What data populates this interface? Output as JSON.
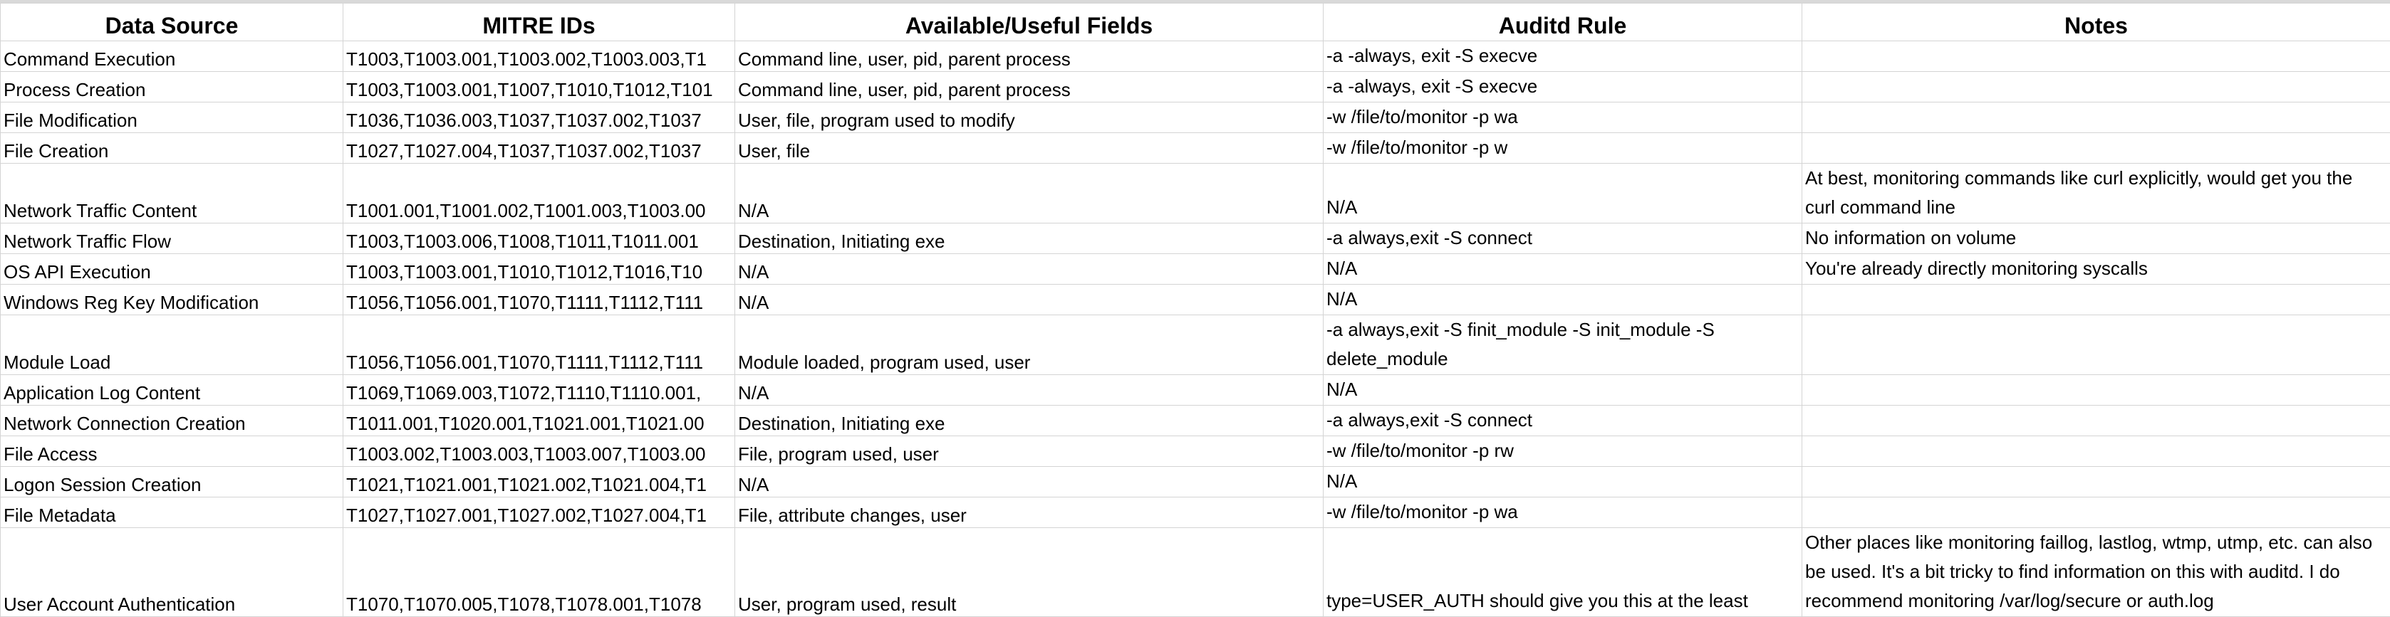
{
  "headers": [
    "Data Source",
    "MITRE IDs",
    "Available/Useful Fields",
    "Auditd Rule",
    "Notes"
  ],
  "rows": [
    {
      "source": "Command Execution",
      "ids": "T1003,T1003.001,T1003.002,T1003.003,T1",
      "fields": "Command line, user, pid, parent process",
      "rule": "-a -always, exit -S execve",
      "notes": ""
    },
    {
      "source": "Process Creation",
      "ids": "T1003,T1003.001,T1007,T1010,T1012,T101",
      "fields": "Command line, user, pid, parent process",
      "rule": "-a -always, exit -S execve",
      "notes": ""
    },
    {
      "source": "File Modification",
      "ids": "T1036,T1036.003,T1037,T1037.002,T1037",
      "fields": "User, file, program used to modify",
      "rule": "-w /file/to/monitor -p wa",
      "notes": ""
    },
    {
      "source": "File Creation",
      "ids": "T1027,T1027.004,T1037,T1037.002,T1037",
      "fields": "User, file",
      "rule": "-w /file/to/monitor -p w",
      "notes": ""
    },
    {
      "source": "Network Traffic Content",
      "ids": "T1001.001,T1001.002,T1001.003,T1003.00",
      "fields": "N/A",
      "rule": "N/A",
      "notes": "At best, monitoring commands like curl explicitly, would get you the curl command line"
    },
    {
      "source": "Network Traffic Flow",
      "ids": "T1003,T1003.006,T1008,T1011,T1011.001",
      "fields": "Destination, Initiating exe",
      "rule": "-a always,exit -S connect",
      "notes": "No information on volume"
    },
    {
      "source": "OS API Execution",
      "ids": "T1003,T1003.001,T1010,T1012,T1016,T10",
      "fields": "N/A",
      "rule": "N/A",
      "notes": "You're already directly monitoring syscalls"
    },
    {
      "source": "Windows Reg Key Modification",
      "ids": "T1056,T1056.001,T1070,T1111,T1112,T111",
      "fields": "N/A",
      "rule": "N/A",
      "notes": ""
    },
    {
      "source": "Module Load",
      "ids": "T1056,T1056.001,T1070,T1111,T1112,T111",
      "fields": "Module loaded, program used, user",
      "rule": "-a always,exit -S finit_module -S init_module -S delete_module",
      "notes": ""
    },
    {
      "source": "Application Log Content",
      "ids": "T1069,T1069.003,T1072,T1110,T1110.001,",
      "fields": "N/A",
      "rule": "N/A",
      "notes": ""
    },
    {
      "source": "Network Connection Creation",
      "ids": "T1011.001,T1020.001,T1021.001,T1021.00",
      "fields": "Destination, Initiating exe",
      "rule": "-a always,exit -S connect",
      "notes": ""
    },
    {
      "source": "File Access",
      "ids": "T1003.002,T1003.003,T1003.007,T1003.00",
      "fields": "File, program used, user",
      "rule": "-w /file/to/monitor -p rw",
      "notes": ""
    },
    {
      "source": "Logon Session Creation",
      "ids": "T1021,T1021.001,T1021.002,T1021.004,T1",
      "fields": "N/A",
      "rule": "N/A",
      "notes": ""
    },
    {
      "source": "File Metadata",
      "ids": "T1027,T1027.001,T1027.002,T1027.004,T1",
      "fields": "File, attribute changes, user",
      "rule": "-w /file/to/monitor -p wa",
      "notes": ""
    },
    {
      "source": "User Account Authentication",
      "ids": "T1070,T1070.005,T1078,T1078.001,T1078",
      "fields": "User, program used, result",
      "rule": "type=USER_AUTH should give you this at the least",
      "notes": "Other places like monitoring faillog, lastlog, wtmp, utmp, etc. can also be used. It's a bit tricky to find information on this with auditd. I do recommend monitoring /var/log/secure or auth.log"
    }
  ]
}
